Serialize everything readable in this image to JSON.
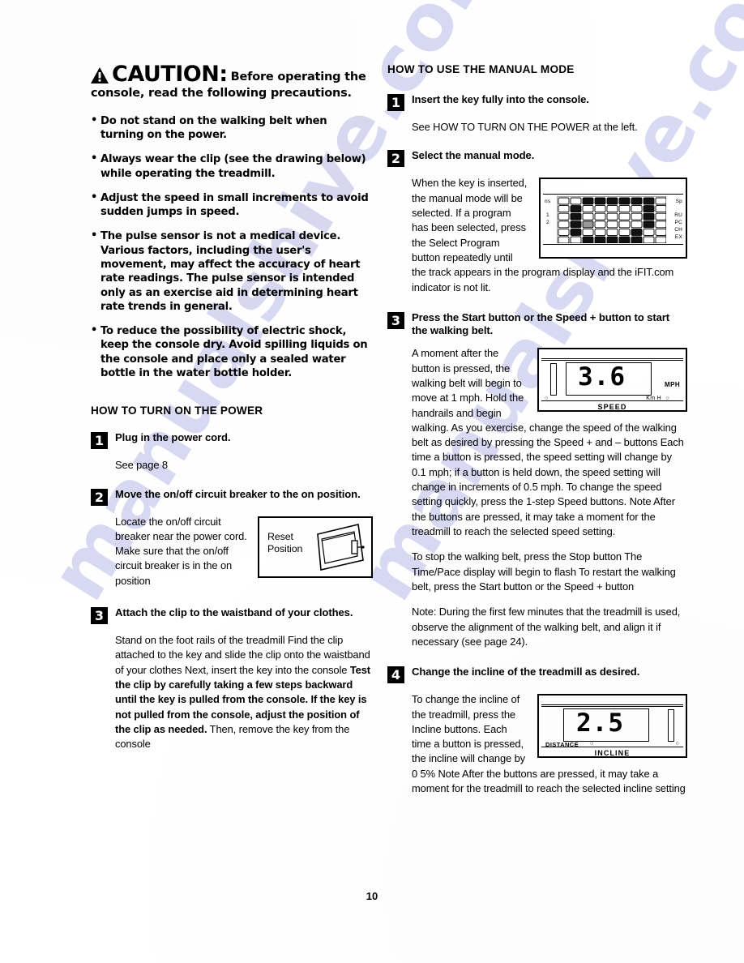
{
  "page": {
    "number": "10",
    "watermark": "manualshive.com",
    "watermark_color": "#b9bbe8"
  },
  "left_column": {
    "caution": {
      "icon": "warning-triangle-icon",
      "word": "CAUTION:",
      "tail": "Before operating the",
      "line2": "console, read the following precautions.",
      "bullets": [
        "Do not stand on the walking belt when turning on the power.",
        "Always wear the clip (see the drawing below) while operating the treadmill.",
        "Adjust the speed in small increments to avoid sudden jumps in speed.",
        "The pulse sensor is not a medical device. Various factors, including the user's movement, may affect the accuracy of heart rate readings. The pulse sensor is intended only as an exercise aid in determining heart rate trends in general.",
        "To reduce the possibility of electric shock, keep the console dry. Avoid spilling liquids on the console and place only a sealed water bottle in the water bottle holder."
      ]
    },
    "section_title": "HOW TO TURN ON THE POWER",
    "steps": [
      {
        "number": "1",
        "title": "Plug in the power cord.",
        "body": "See page 8"
      },
      {
        "number": "2",
        "title": "Move the on/off circuit breaker to the on position.",
        "body": "Locate the on/off circuit breaker near the power cord. Make sure that the on/off circuit breaker is in the on position",
        "figure": {
          "name": "reset-position-figure",
          "label_line1": "Reset",
          "label_line2": "Position"
        }
      },
      {
        "number": "3",
        "title": "Attach the clip to the waistband of your clothes.",
        "body_plain_1": "Stand on the foot rails of the treadmill  Find the clip attached to the key and slide the clip onto the waistband of your clothes  Next, insert the key into the console  ",
        "body_bold": "Test the clip by carefully taking a few steps backward until the key is pulled from the console. If the key is not pulled from the console, adjust the position of the clip as needed.",
        "body_plain_2": " Then, remove the key from the console"
      }
    ]
  },
  "right_column": {
    "section_title": "HOW TO USE THE MANUAL MODE",
    "steps": [
      {
        "number": "1",
        "title": "Insert the key fully into the console.",
        "body": "See HOW TO TURN ON THE POWER at the left."
      },
      {
        "number": "2",
        "title": "Select the manual mode.",
        "body": "When the key is inserted, the manual mode will be selected. If a program has been selected, press the Select Program button repeatedly until the track appears in the program display and the iFIT.com indicator is not lit.",
        "figure": {
          "name": "program-display-figure",
          "left_labels": [
            "ns",
            "1",
            "2"
          ],
          "right_labels": [
            "Sp",
            "RU",
            "PC",
            "CH",
            "EX"
          ]
        }
      },
      {
        "number": "3",
        "title": "Press the Start button or the Speed + button to start the walking belt.",
        "body_1": "A moment after the button is pressed, the walking belt will begin to move at 1 mph. Hold the handrails and begin walking. As you exercise, change the speed of the walking belt as desired by pressing the Speed + and – buttons  Each time a button is pressed, the speed setting will change by 0.1 mph; if a button is held down, the speed setting will change in increments of 0.5 mph. To change the speed setting quickly, press the 1-step Speed buttons. Note  After the buttons are pressed, it may take a moment for the treadmill to reach the selected speed setting.",
        "body_2": "To stop the walking belt, press the Stop button  The Time/Pace display will begin to flash  To restart the walking belt, press the Start button or the Speed + button",
        "body_3": "Note: During the first few minutes that the treadmill is used, observe the alignment of the walking belt, and align it if necessary (see page 24).",
        "figure": {
          "name": "speed-display-figure",
          "value": "3.6",
          "unit": "MPH",
          "sub_unit": "Km H",
          "bottom_label": "SPEED"
        }
      },
      {
        "number": "4",
        "title": "Change the incline of the treadmill as desired.",
        "body": "To change the incline of the treadmill, press the Incline buttons. Each time a button is pressed, the incline will change by 0 5%  Note  After the buttons are pressed, it may take a moment for the treadmill to reach the selected incline setting",
        "figure": {
          "name": "incline-display-figure",
          "value": "2.5",
          "distance_label": "DISTANCE",
          "bottom_label": "INCLINE"
        }
      }
    ]
  }
}
